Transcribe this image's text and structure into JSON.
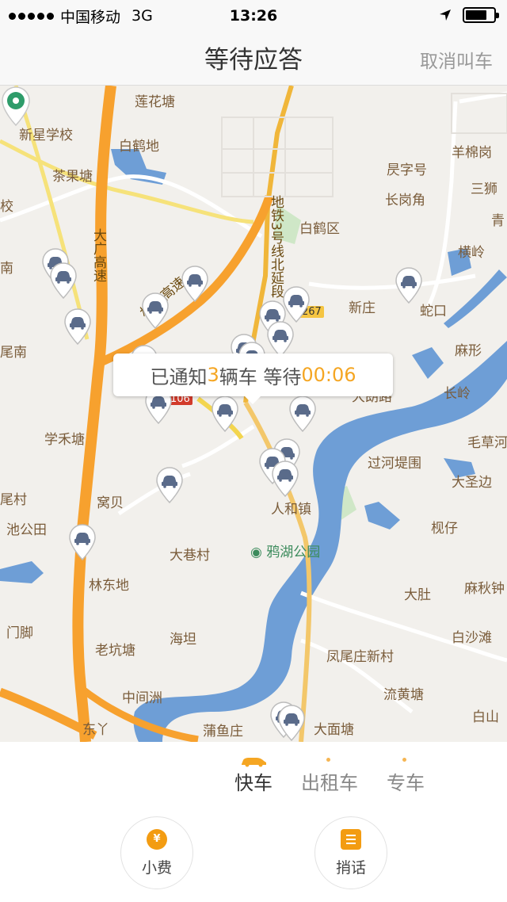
{
  "status_bar": {
    "carrier": "中国移动",
    "network": "3G",
    "time": "13:26",
    "signal_bars": 5,
    "battery_level": 0.75
  },
  "nav": {
    "title": "等待应答",
    "cancel_label": "取消叫车"
  },
  "callout": {
    "prefix": "已通知",
    "car_count": "3",
    "middle": "辆车 等待",
    "timer": "00:06"
  },
  "map": {
    "places": [
      "莲花塘",
      "新星学校",
      "白鹤地",
      "茶果塘",
      "校",
      "白鹤区",
      "昃字号",
      "长岗角",
      "三狮",
      "青",
      "羊棉岗",
      "横岭",
      "新庄",
      "蛇口",
      "麻形",
      "长岭",
      "南",
      "尾南",
      "学禾塘",
      "尾村",
      "池公田",
      "窝贝",
      "人和镇",
      "大巷村",
      "林东地",
      "门脚",
      "老坑塘",
      "海坦",
      "中间洲",
      "东丫",
      "蒲鱼庄",
      "大面塘",
      "流黄塘",
      "白山",
      "凤尾庄新村",
      "白沙滩",
      "大肚",
      "麻秋钟",
      "枧仔",
      "大圣边",
      "过河堤围",
      "毛草河",
      "大朗路"
    ],
    "roads": [
      "大广高速",
      "机场高速",
      "地铁3号线北延段"
    ],
    "poi_park": "鸦湖公园",
    "road_badges": [
      "267",
      "106"
    ]
  },
  "tabs": [
    {
      "label": "快车",
      "active": true
    },
    {
      "label": "出租车",
      "active": false
    },
    {
      "label": "专车",
      "active": false
    }
  ],
  "actions": {
    "tip_label": "小费",
    "tip_icon": "¥",
    "message_label": "捎话"
  },
  "colors": {
    "accent": "#f5a623",
    "water": "#6e9ed6",
    "highway": "#f7a12e",
    "pin_green": "#2e9c6a"
  }
}
